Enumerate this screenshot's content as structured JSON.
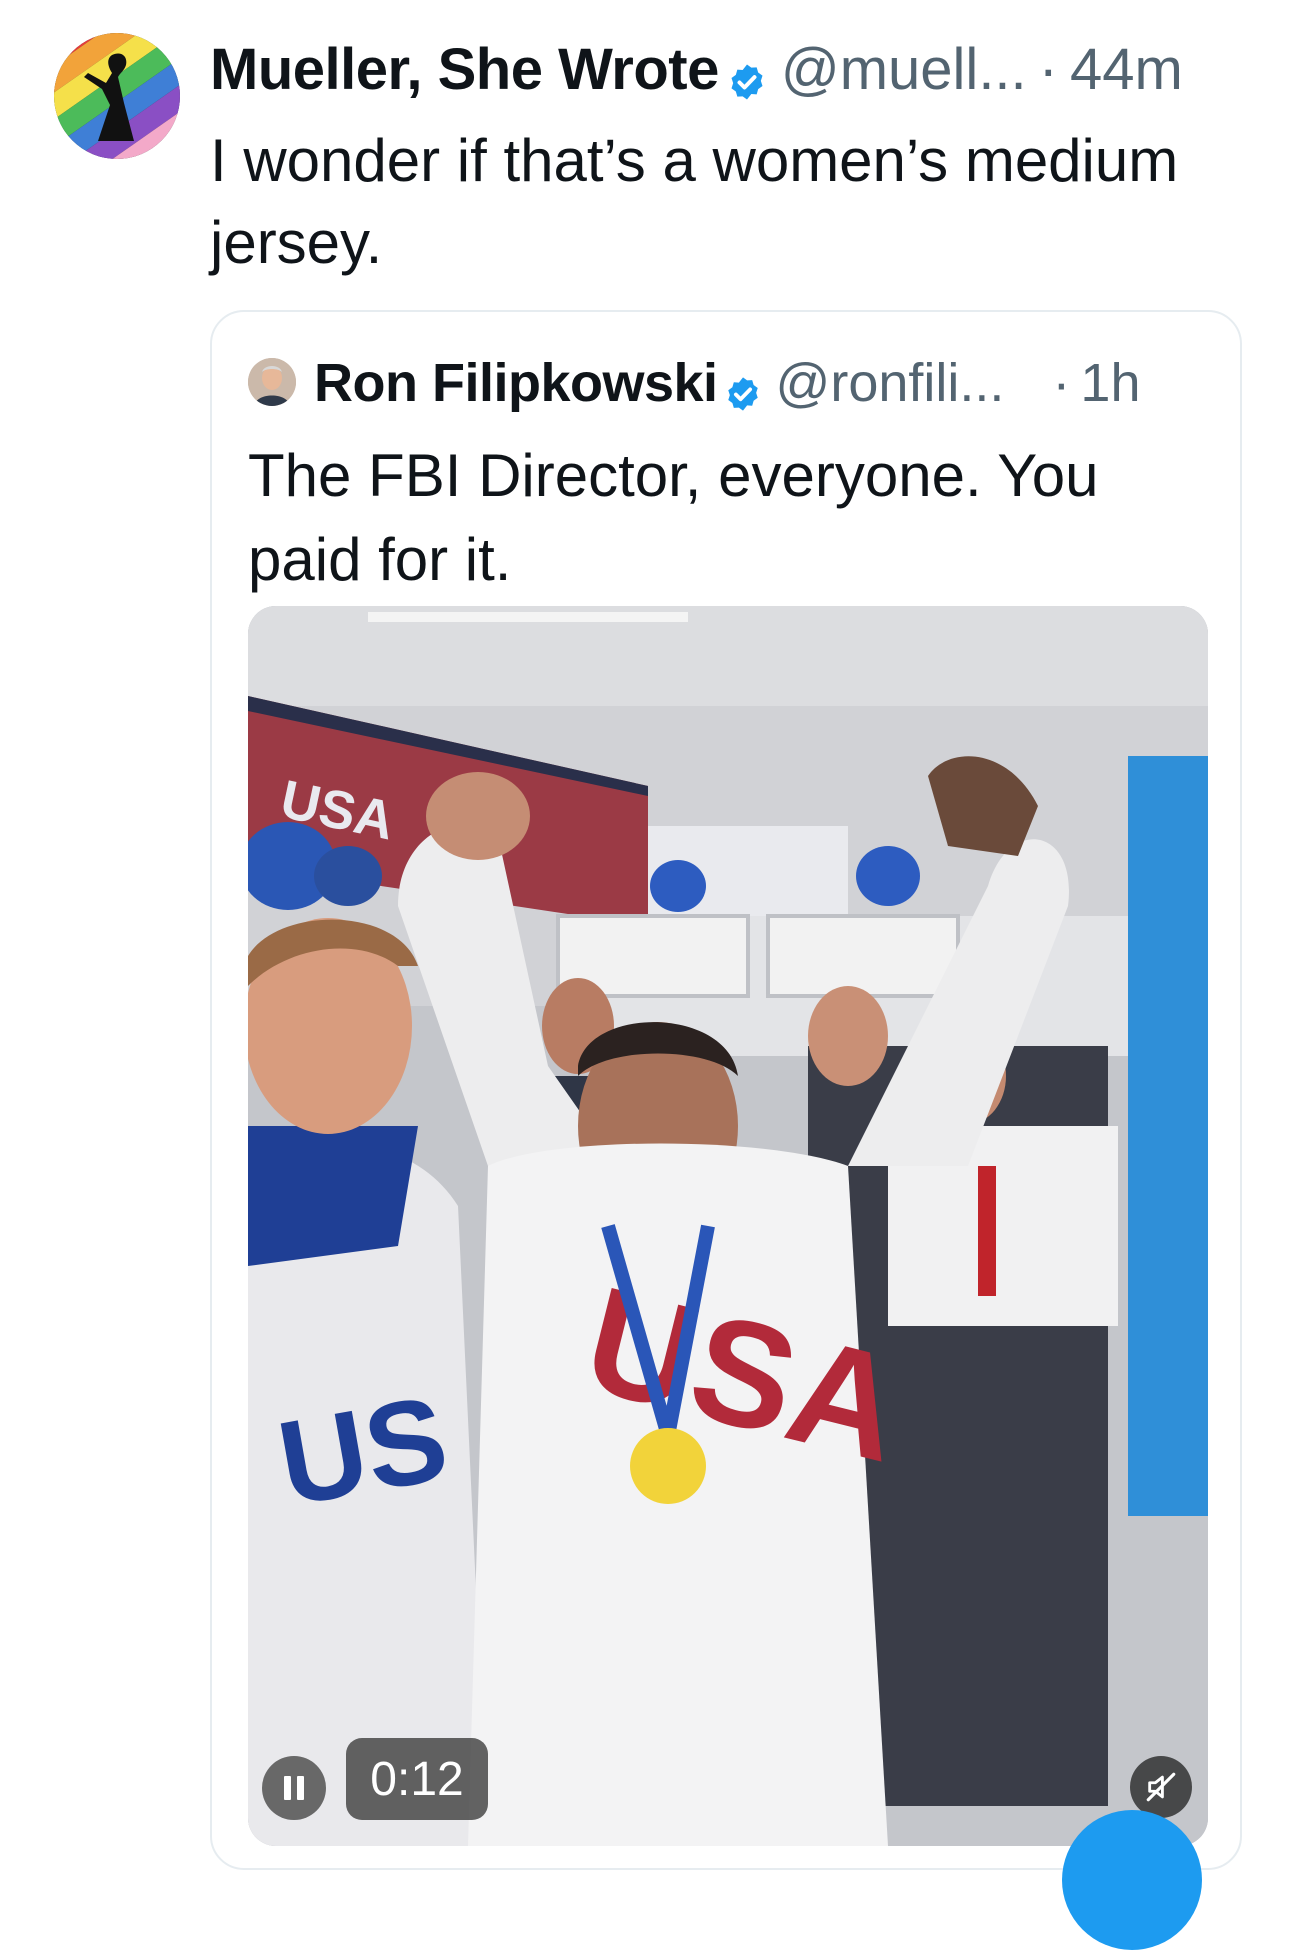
{
  "tweet": {
    "author_name": "Mueller, She Wrote",
    "handle": "@muell...",
    "separator": "·",
    "time": "44m",
    "text": "I wonder if that’s a women’s medium jersey."
  },
  "quoted_tweet": {
    "author_name": "Ron Filipkowski",
    "handle": "@ronfili...",
    "separator": "·",
    "time": "1h",
    "text": "The FBI Director, everyone. You paid for it.",
    "media": {
      "banner_text": "USA",
      "jersey_text": "USA",
      "duration": "0:12",
      "playback": "pause-icon",
      "audio": "muted-speaker-icon"
    }
  },
  "colors": {
    "verified": "#1d9bf0",
    "secondary_text": "#536471",
    "fab": "#1d9bf0"
  }
}
